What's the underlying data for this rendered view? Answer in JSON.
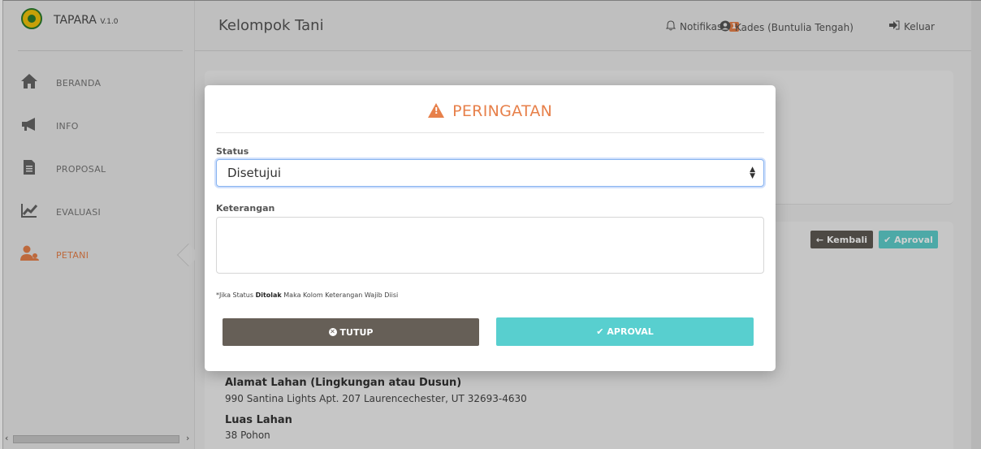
{
  "brand": {
    "name": "TAPARA",
    "version": "V.1.0"
  },
  "sidebar": {
    "items": [
      {
        "label": "BERANDA",
        "icon": "home-icon"
      },
      {
        "label": "INFO",
        "icon": "megaphone-icon"
      },
      {
        "label": "PROPOSAL",
        "icon": "document-icon"
      },
      {
        "label": "EVALUASI",
        "icon": "chart-icon"
      },
      {
        "label": "PETANI",
        "icon": "users-icon",
        "active": true
      }
    ]
  },
  "topbar": {
    "title": "Kelompok Tani",
    "notifications_label": "Notifikasi",
    "notifications_count": "1",
    "user_label": "Kades (Buntulia Tengah)",
    "logout_label": "Keluar"
  },
  "background": {
    "kembali_label": "Kembali",
    "aproval_label": "Aproval",
    "alamat_label": "Alamat Lahan (Lingkungan atau Dusun)",
    "alamat_value": "990 Santina Lights Apt. 207 Laurencechester, UT 32693-4630",
    "luas_label": "Luas Lahan",
    "luas_value": "38 Pohon"
  },
  "modal": {
    "title": "PERINGATAN",
    "status_label": "Status",
    "status_value": "Disetujui",
    "keterangan_label": "Keterangan",
    "keterangan_value": "",
    "note_prefix": "*Jika Status ",
    "note_bold": "Ditolak",
    "note_suffix": " Maka Kolom Keterangan Wajib Diisi",
    "tutup_label": "TUTUP",
    "aproval_label": "APROVAL"
  },
  "colors": {
    "accent": "#e7804a",
    "teal": "#58cfcf",
    "dark": "#665f57"
  }
}
